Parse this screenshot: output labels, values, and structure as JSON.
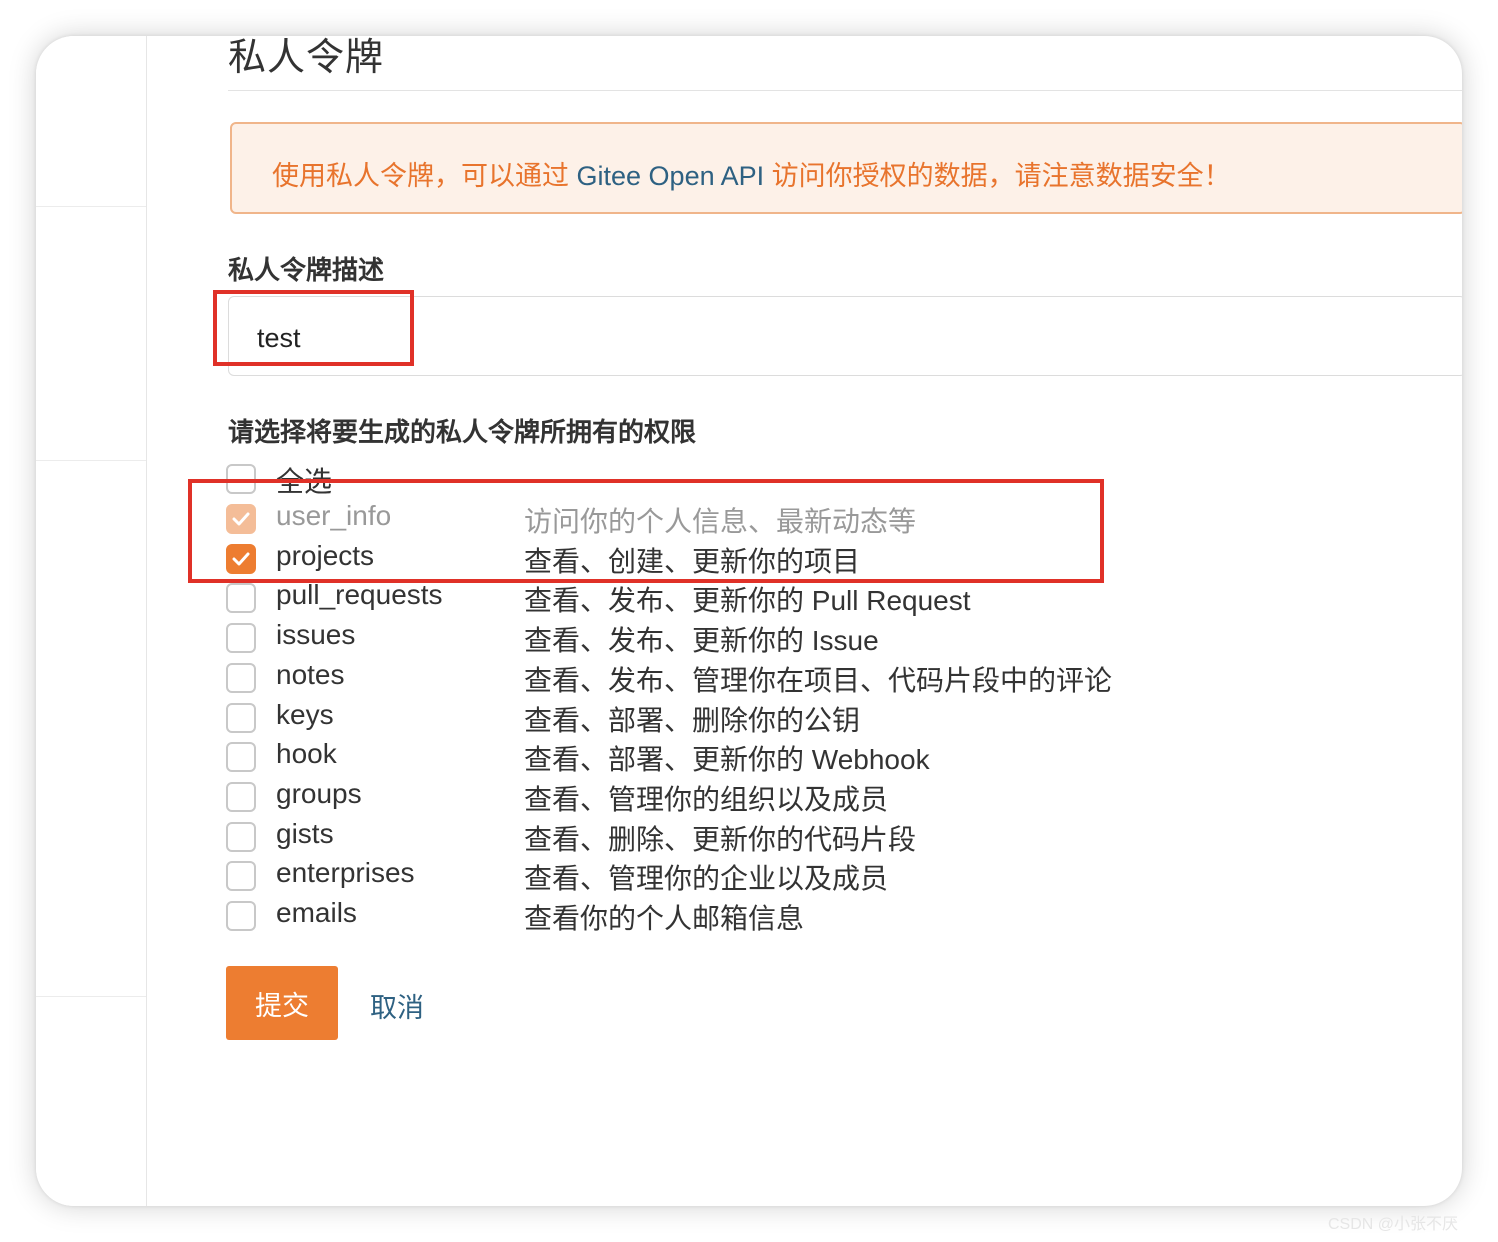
{
  "page": {
    "title": "私人令牌",
    "notice": {
      "prefix": "使用私人令牌，可以通过 ",
      "api": "Gitee Open API",
      "suffix": " 访问你授权的数据，请注意数据安全！"
    },
    "description_label": "私人令牌描述",
    "description_value": "test",
    "permissions_label": "请选择将要生成的私人令牌所拥有的权限",
    "select_all_label": "全选",
    "permissions": [
      {
        "name": "user_info",
        "desc": "访问你的个人信息、最新动态等",
        "checked": true,
        "disabled": true
      },
      {
        "name": "projects",
        "desc": "查看、创建、更新你的项目",
        "checked": true,
        "disabled": false
      },
      {
        "name": "pull_requests",
        "desc": "查看、发布、更新你的 Pull Request",
        "checked": false,
        "disabled": false
      },
      {
        "name": "issues",
        "desc": "查看、发布、更新你的 Issue",
        "checked": false,
        "disabled": false
      },
      {
        "name": "notes",
        "desc": "查看、发布、管理你在项目、代码片段中的评论",
        "checked": false,
        "disabled": false
      },
      {
        "name": "keys",
        "desc": "查看、部署、删除你的公钥",
        "checked": false,
        "disabled": false
      },
      {
        "name": "hook",
        "desc": "查看、部署、更新你的 Webhook",
        "checked": false,
        "disabled": false
      },
      {
        "name": "groups",
        "desc": "查看、管理你的组织以及成员",
        "checked": false,
        "disabled": false
      },
      {
        "name": "gists",
        "desc": "查看、删除、更新你的代码片段",
        "checked": false,
        "disabled": false
      },
      {
        "name": "enterprises",
        "desc": "查看、管理你的企业以及成员",
        "checked": false,
        "disabled": false
      },
      {
        "name": "emails",
        "desc": "查看你的个人邮箱信息",
        "checked": false,
        "disabled": false
      }
    ],
    "submit_label": "提交",
    "cancel_label": "取消",
    "watermark": "CSDN @小张不厌"
  },
  "colors": {
    "accent": "#ed7d31",
    "notice_bg": "#fdf1e8",
    "notice_text": "#e8742d",
    "link": "#2e6182",
    "annotation_red": "#e03128"
  }
}
